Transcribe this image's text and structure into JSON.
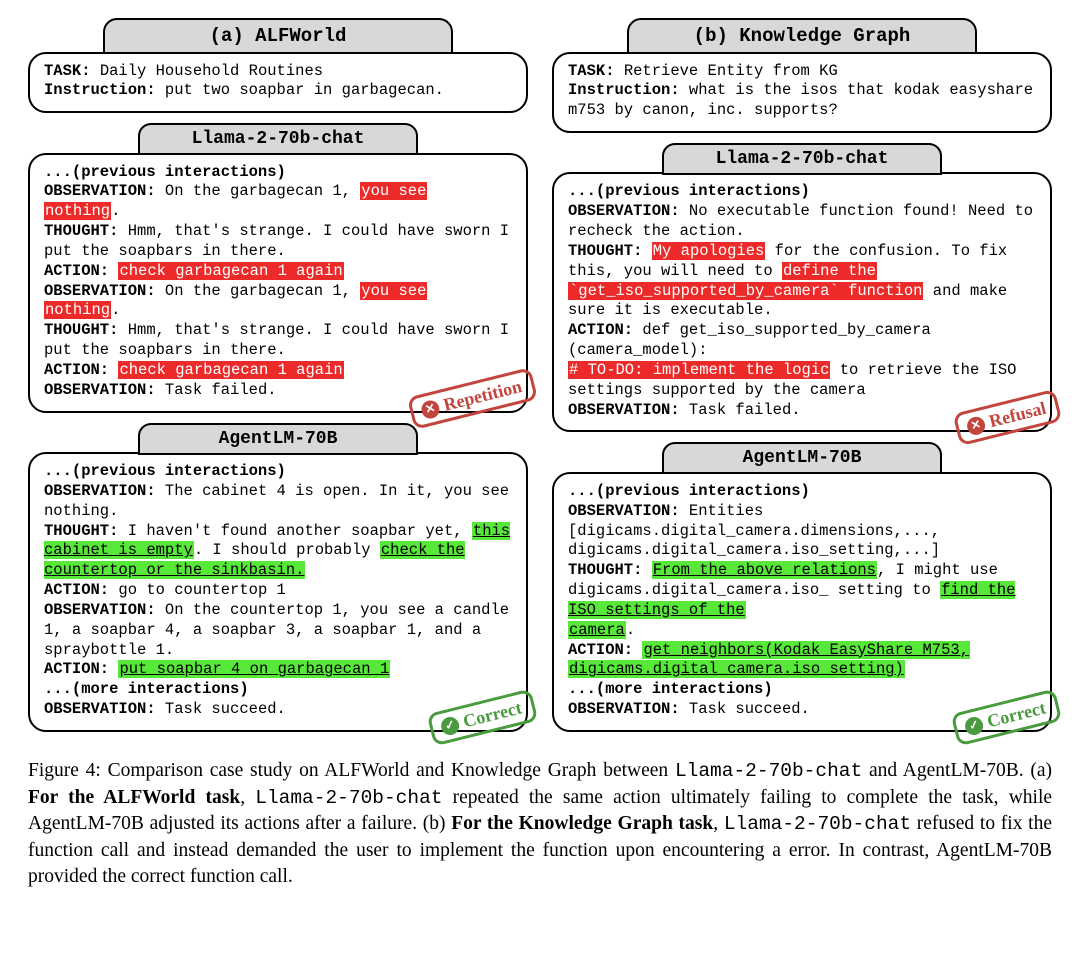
{
  "left": {
    "panel_title": "(a) ALFWorld",
    "task_box": {
      "task_label": "TASK:",
      "task_value": " Daily Household Routines",
      "instr_label": "Instruction:",
      "instr_value": " put two soapbar in garbagecan."
    },
    "llama": {
      "title": "Llama-2-70b-chat",
      "stamp": "Repetition",
      "stamp_icon": "✕",
      "prev": "...(previous interactions)",
      "obs1a": "OBSERVATION:",
      "obs1b": " On the garbagecan 1, ",
      "obs1c": "you see ",
      "obs1d": "nothing",
      "obs1e": ".",
      "th1a": "THOUGHT:",
      "th1b": " Hmm, that's strange. I could have sworn I put the soapbars in there.",
      "ac1a": "ACTION:",
      "ac1b": " ",
      "ac1c": "check garbagecan 1 again",
      "obs2a": "OBSERVATION:",
      "obs2b": " On the garbagecan 1, ",
      "obs2c": "you see ",
      "obs2d": "nothing",
      "obs2e": ".",
      "th2a": "THOUGHT:",
      "th2b": " Hmm, that's strange. I could have sworn I put the soapbars in there.",
      "ac2a": "ACTION:",
      "ac2b": " ",
      "ac2c": "check garbagecan 1 again",
      "obs3a": "OBSERVATION:",
      "obs3b": " Task failed."
    },
    "agent": {
      "title": "AgentLM-70B",
      "stamp": "Correct",
      "stamp_icon": "✓",
      "prev": "...(previous interactions)",
      "obs1a": "OBSERVATION:",
      "obs1b": " The cabinet 4 is open. In it, you see nothing.",
      "th1a": "THOUGHT:",
      "th1b": " I haven't found another soapbar yet, ",
      "th1c": "this cabinet is empty",
      "th1d": ". I should probably ",
      "th1e": "check the countertop or the sinkbasin.",
      "ac1a": "ACTION:",
      "ac1b": " go to countertop 1",
      "obs2a": "OBSERVATION:",
      "obs2b": " On the countertop 1, you see a candle 1, a soapbar 4, a soapbar 3, a soapbar 1, and a spraybottle 1.",
      "ac2a": "ACTION:",
      "ac2b": " ",
      "ac2c": "put soapbar 4 on garbagecan 1",
      "more": "...(more interactions)",
      "obs3a": "OBSERVATION:",
      "obs3b": " Task succeed."
    }
  },
  "right": {
    "panel_title": "(b) Knowledge Graph",
    "task_box": {
      "task_label": "TASK:",
      "task_value": " Retrieve Entity from KG",
      "instr_label": "Instruction:",
      "instr_value": " what is the isos that kodak easyshare m753 by canon, inc. supports?"
    },
    "llama": {
      "title": "Llama-2-70b-chat",
      "stamp": "Refusal",
      "stamp_icon": "✕",
      "prev": "...(previous interactions)",
      "obs1a": "OBSERVATION:",
      "obs1b": " No executable function found! Need to recheck the action.",
      "th1a": "THOUGHT:",
      "th1b": " ",
      "th1c": "My apologies",
      "th1d": " for the confusion. To fix this, you will need to ",
      "th1e": "define the ",
      "th1f": "`get_iso_supported_by_camera` function",
      "th1g": " and make sure it is executable.",
      "ac1a": "ACTION:",
      "ac1b": " def get_iso_supported_by_camera (camera_model):",
      "ac1c": "# TO-DO: implement the logic",
      "ac1d": " to retrieve the ISO settings supported by the camera",
      "obs2a": "OBSERVATION:",
      "obs2b": " Task failed."
    },
    "agent": {
      "title": "AgentLM-70B",
      "stamp": "Correct",
      "stamp_icon": "✓",
      "prev": "...(previous interactions)",
      "obs1a": "OBSERVATION:",
      "obs1b": " Entities [digicams.digital_camera.dimensions,..., digicams.digital_camera.iso_setting,...]",
      "th1a": "THOUGHT:",
      "th1b": " ",
      "th1c": "From the above relations",
      "th1d": ", I might use digicams.digital_camera.iso_ setting to ",
      "th1e": "find the ISO settings of the ",
      "th1f": "camera",
      "th1g": ".",
      "ac1a": "ACTION:",
      "ac1b": " ",
      "ac1c": "get_neighbors(Kodak EasyShare M753, ",
      "ac1d": "digicams.digital_camera.iso_setting)",
      "more": "...(more interactions)",
      "obs2a": "OBSERVATION:",
      "obs2b": " Task succeed."
    }
  },
  "caption": {
    "lead": "Figure 4:   Comparison case study on ALFWorld and Knowledge Graph between ",
    "m1": "Llama-2-70b-chat",
    "t1": " and AgentLM-70B. (a) ",
    "b1": "For the ALFWorld task",
    "t2": ", ",
    "m2": "Llama-2-70b-chat",
    "t3": " repeated the same action ultimately failing to complete the task, while AgentLM-70B adjusted its actions after a failure. (b) ",
    "b2": "For the Knowledge Graph task",
    "t4": ", ",
    "m3": "Llama-2-70b-chat",
    "t5": " refused to fix the function call and instead demanded the user to implement the function upon encountering a error. In contrast, AgentLM-70B provided the correct function call."
  }
}
